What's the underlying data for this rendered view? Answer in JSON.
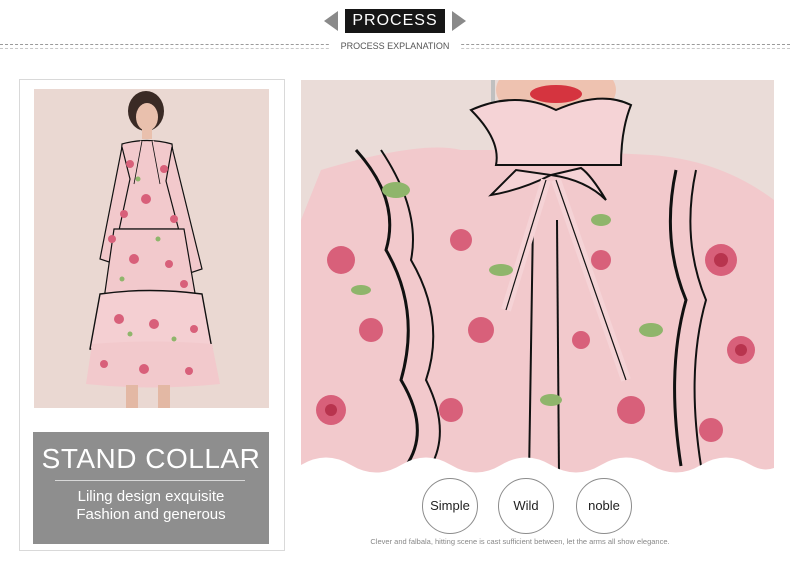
{
  "header": {
    "badge": "PROCESS",
    "subtitle": "PROCESS EXPLANATION"
  },
  "caption": {
    "title": "STAND COLLAR",
    "line1": "Liling design exquisite",
    "line2": "Fashion and generous"
  },
  "features": [
    "Simple",
    "Wild",
    "noble"
  ],
  "footnote": "Clever and falbala, hitting scene is cast sufficient between, let the arms all show elegance.",
  "colors": {
    "badge_bg": "#161616",
    "caption_bg": "#8e8e8e",
    "dress_pink": "#f2c9cc",
    "flower": "#d8607a",
    "trim": "#111111"
  }
}
